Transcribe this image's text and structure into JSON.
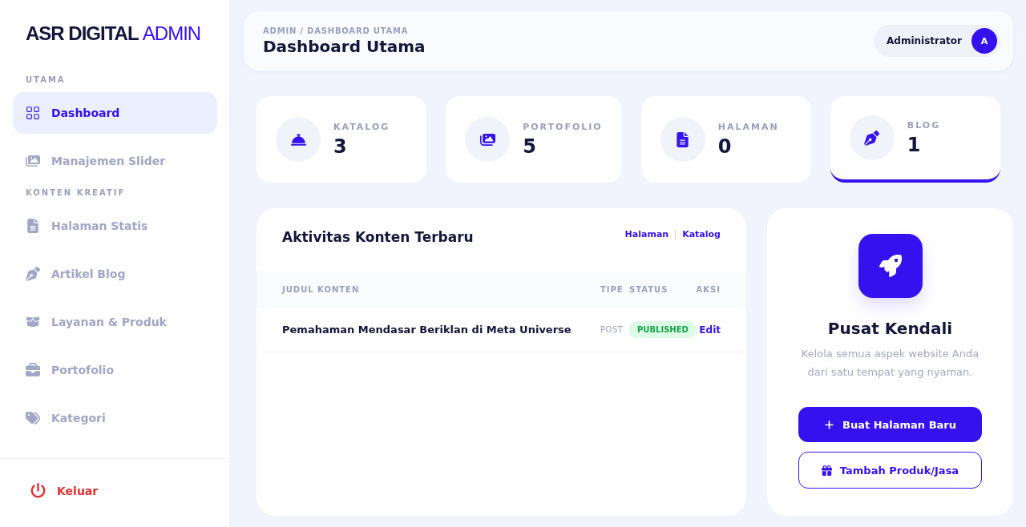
{
  "brand": {
    "name": "ASR DIGITAL",
    "accent": "ADMIN"
  },
  "sidebar": {
    "items": [
      {
        "kind": "section",
        "label": "UTAMA"
      },
      {
        "kind": "link",
        "label": "Dashboard",
        "selected": true
      },
      {
        "kind": "link",
        "label": "Manajemen Slider",
        "selected": false
      },
      {
        "kind": "section",
        "label": "KONTEN KREATIF"
      },
      {
        "kind": "link",
        "label": "Halaman Statis",
        "selected": false
      },
      {
        "kind": "link",
        "label": "Artikel Blog",
        "selected": false
      },
      {
        "kind": "link",
        "label": "Layanan & Produk",
        "selected": false
      },
      {
        "kind": "link",
        "label": "Portofolio",
        "selected": false
      },
      {
        "kind": "link",
        "label": "Kategori",
        "selected": false
      }
    ],
    "logout": "Keluar"
  },
  "header": {
    "breadcrumb": "ADMIN / DASHBOARD UTAMA",
    "title": "Dashboard Utama",
    "user": "Administrator",
    "avatar": "A"
  },
  "stats": [
    {
      "label": "KATALOG",
      "value": "3",
      "selected": false
    },
    {
      "label": "PORTOFOLIO",
      "value": "5",
      "selected": false
    },
    {
      "label": "HALAMAN",
      "value": "0",
      "selected": false
    },
    {
      "label": "BLOG",
      "value": "1",
      "selected": true
    }
  ],
  "activity": {
    "title": "Aktivitas Konten Terbaru",
    "links": [
      "Halaman",
      "Katalog"
    ],
    "columns": [
      "JUDUL KONTEN",
      "TIPE",
      "STATUS",
      "AKSI"
    ],
    "rows": [
      {
        "title": "Pemahaman Mendasar Beriklan di Meta Universe",
        "type": "POST",
        "status": "PUBLISHED",
        "action": "Edit"
      }
    ]
  },
  "control": {
    "title": "Pusat Kendali",
    "text": "Kelola semua aspek website Anda dari satu tempat yang nyaman.",
    "buttons": [
      {
        "kind": "primary",
        "label": "Buat Halaman Baru"
      },
      {
        "kind": "outline",
        "label": "Tambah Produk/Jasa"
      }
    ]
  }
}
